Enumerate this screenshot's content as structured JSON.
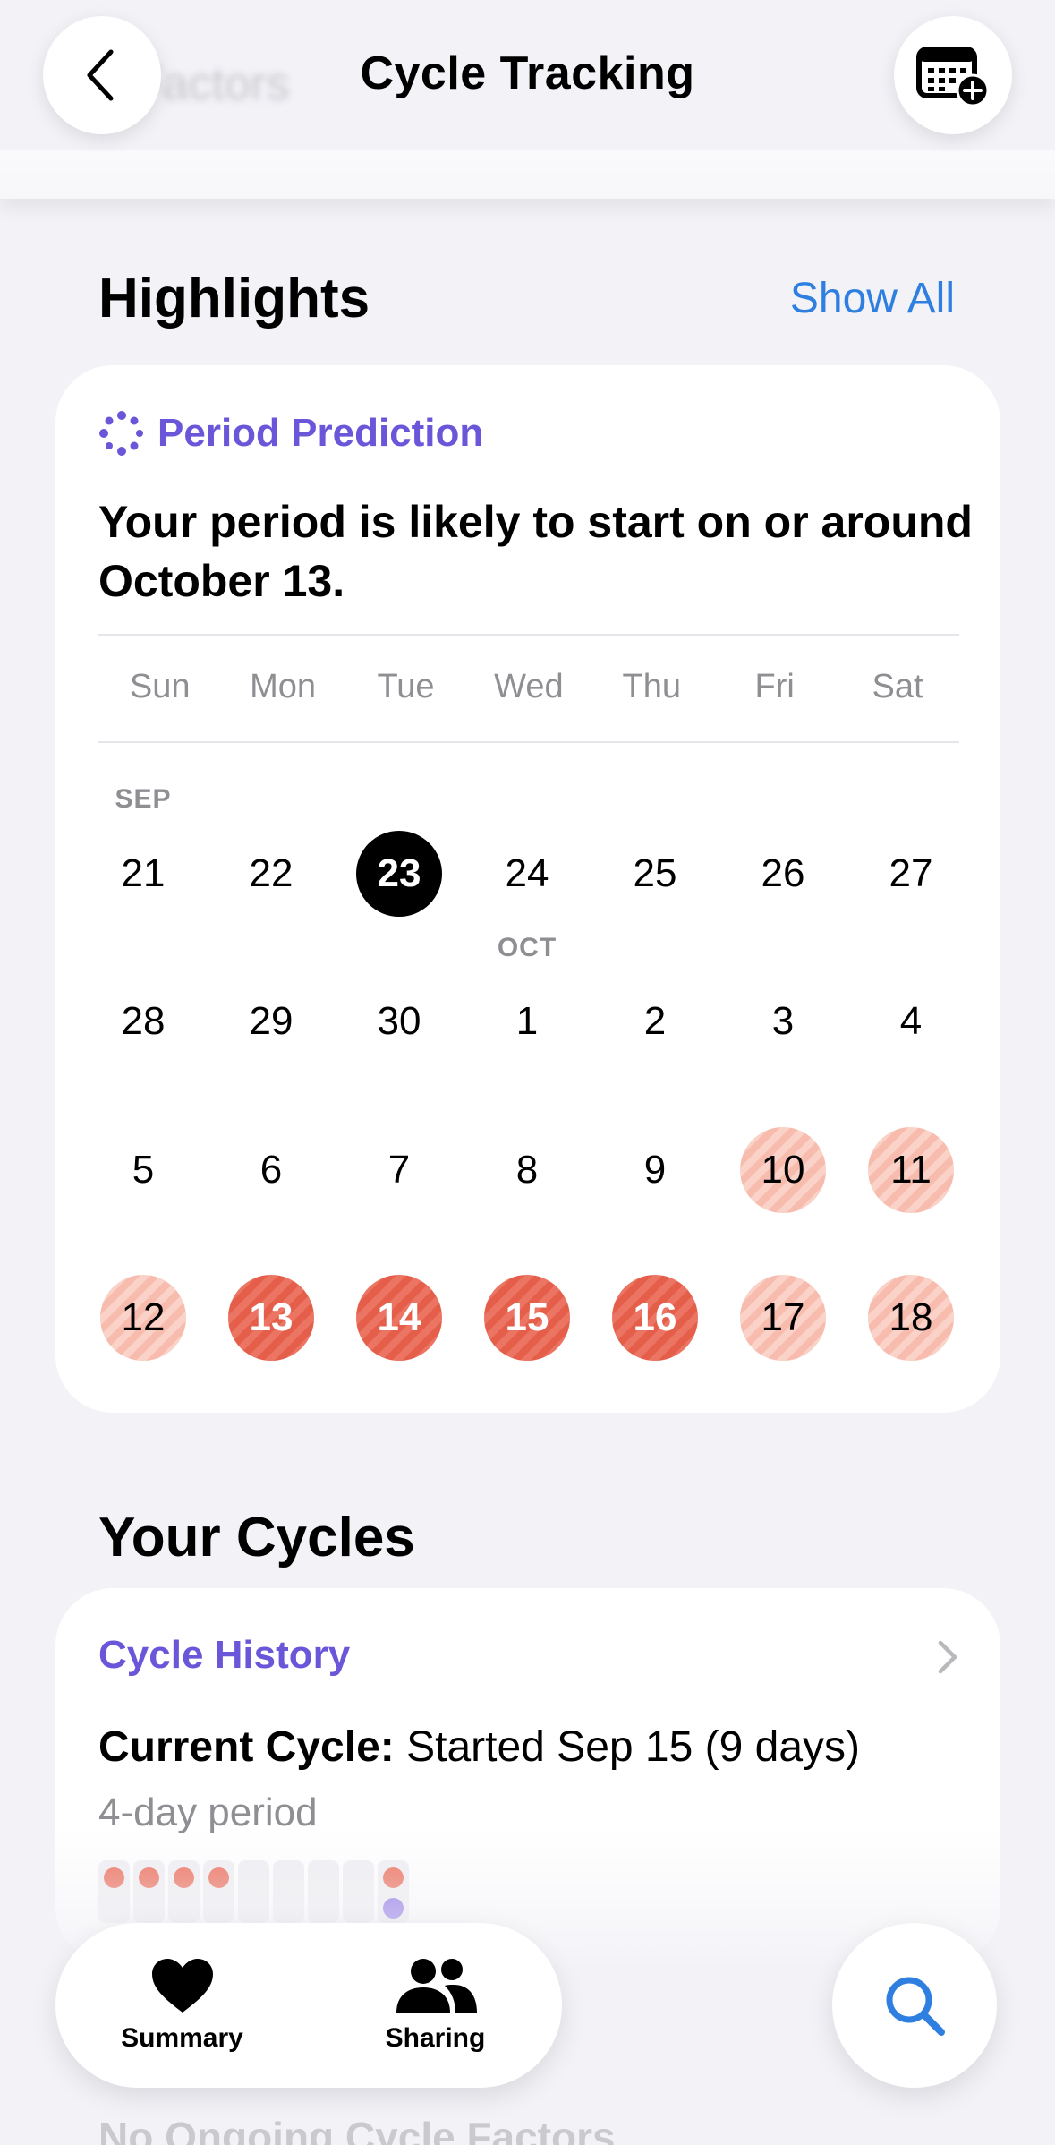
{
  "header": {
    "ghost_title": "Factors",
    "title": "Cycle Tracking"
  },
  "highlights": {
    "title": "Highlights",
    "show_all": "Show All",
    "card": {
      "label": "Period Prediction",
      "text": "Your period is likely to start on or around October 13."
    }
  },
  "calendar": {
    "weekdays": [
      "Sun",
      "Mon",
      "Tue",
      "Wed",
      "Thu",
      "Fri",
      "Sat"
    ],
    "months": {
      "sep": "SEP",
      "oct": "OCT"
    },
    "weeks": [
      [
        {
          "d": "21"
        },
        {
          "d": "22"
        },
        {
          "d": "23",
          "s": "today"
        },
        {
          "d": "24"
        },
        {
          "d": "25"
        },
        {
          "d": "26"
        },
        {
          "d": "27"
        }
      ],
      [
        {
          "d": "28"
        },
        {
          "d": "29"
        },
        {
          "d": "30"
        },
        {
          "d": "1"
        },
        {
          "d": "2"
        },
        {
          "d": "3"
        },
        {
          "d": "4"
        }
      ],
      [
        {
          "d": "5"
        },
        {
          "d": "6"
        },
        {
          "d": "7"
        },
        {
          "d": "8"
        },
        {
          "d": "9"
        },
        {
          "d": "10",
          "s": "light"
        },
        {
          "d": "11",
          "s": "light"
        }
      ],
      [
        {
          "d": "12",
          "s": "light"
        },
        {
          "d": "13",
          "s": "strong"
        },
        {
          "d": "14",
          "s": "strong"
        },
        {
          "d": "15",
          "s": "strong"
        },
        {
          "d": "16",
          "s": "strong"
        },
        {
          "d": "17",
          "s": "light"
        },
        {
          "d": "18",
          "s": "light"
        }
      ]
    ]
  },
  "cycles": {
    "title": "Your Cycles",
    "card": {
      "label": "Cycle History",
      "current_label": "Current Cycle:",
      "current_value": " Started Sep 15 (9 days)",
      "period": "4-day period",
      "days": [
        {
          "red": true,
          "purple": false
        },
        {
          "red": true,
          "purple": false
        },
        {
          "red": true,
          "purple": false
        },
        {
          "red": true,
          "purple": false
        },
        {
          "red": false,
          "purple": false
        },
        {
          "red": false,
          "purple": false
        },
        {
          "red": false,
          "purple": false
        },
        {
          "red": false,
          "purple": false
        },
        {
          "red": true,
          "purple": true
        }
      ]
    }
  },
  "below": {
    "text": "No Ongoing Cycle Factors"
  },
  "tabbar": {
    "summary": "Summary",
    "sharing": "Sharing"
  },
  "colors": {
    "accent_purple": "#6a56d9",
    "link_blue": "#2f7fe0",
    "period_light": "#f7bcae",
    "period_strong": "#e45e4a"
  },
  "icons": [
    "back-chevron-icon",
    "calendar-add-icon",
    "sparkle-dots-icon",
    "chevron-right-icon",
    "heart-icon",
    "people-icon",
    "search-icon"
  ]
}
